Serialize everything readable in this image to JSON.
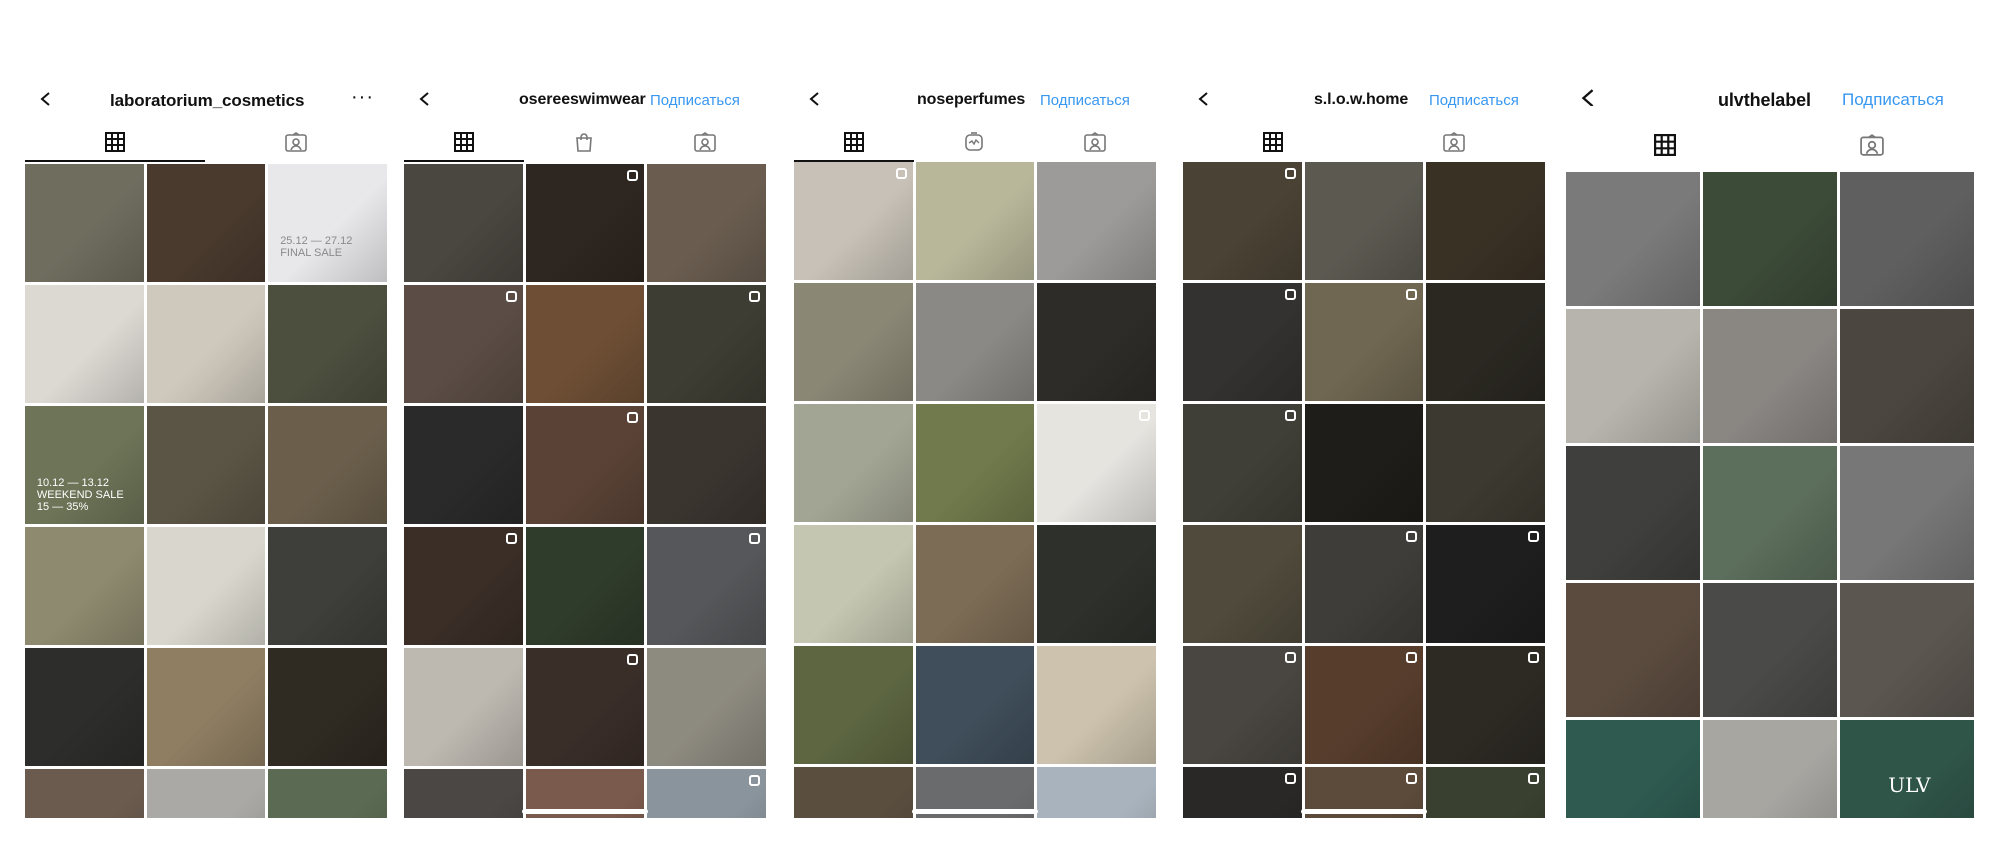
{
  "profiles": [
    {
      "username": "laboratorium_cosmetics",
      "action": "",
      "more": "···",
      "tabs": [
        "grid-icon",
        "tagged-icon"
      ],
      "tiles": [
        {
          "c": "#6f6d5e"
        },
        {
          "c": "#4a3a2e"
        },
        {
          "c": "#e8e8ea",
          "text": "25.12 — 27.12\nFINAL SALE",
          "dark": true
        },
        {
          "c": "#dcd9d3"
        },
        {
          "c": "#cfc9bd"
        },
        {
          "c": "#4c4f3e"
        },
        {
          "c": "#6d7457",
          "text": "10.12 — 13.12\nWEEKEND SALE\n15 — 35%"
        },
        {
          "c": "#5b5545"
        },
        {
          "c": "#6b5f4c"
        },
        {
          "c": "#8e8a6f"
        },
        {
          "c": "#d9d7cd"
        },
        {
          "c": "#3e3e3a"
        },
        {
          "c": "#2d2d2b"
        },
        {
          "c": "#8f7e62"
        },
        {
          "c": "#2f2a22"
        },
        {
          "c": "#6b5b4f"
        },
        {
          "c": "#aaa9a6"
        },
        {
          "c": "#5b6a52"
        }
      ]
    },
    {
      "username": "osereeswimwear",
      "action": "Подписаться",
      "tabs": [
        "grid-icon",
        "shop-icon",
        "tagged-icon"
      ],
      "tiles": [
        {
          "c": "#4a4640"
        },
        {
          "c": "#2e2620",
          "b": true
        },
        {
          "c": "#6a5d50"
        },
        {
          "c": "#5b4d45",
          "b": true
        },
        {
          "c": "#6e4f35"
        },
        {
          "c": "#3d3d33",
          "b": true
        },
        {
          "c": "#2a2a2a"
        },
        {
          "c": "#5a4336",
          "b": true
        },
        {
          "c": "#3b3530"
        },
        {
          "c": "#3a2e27",
          "b": true
        },
        {
          "c": "#2f3b2b"
        },
        {
          "c": "#56575a",
          "b": true
        },
        {
          "c": "#bdb8b0"
        },
        {
          "c": "#3a2e29",
          "b": true
        },
        {
          "c": "#8d8a80"
        },
        {
          "c": "#4a4744"
        },
        {
          "c": "#7a5a4c"
        },
        {
          "c": "#8a949c",
          "b": true
        }
      ]
    },
    {
      "username": "noseperfumes",
      "action": "Подписаться",
      "tabs": [
        "grid-icon",
        "reels-icon",
        "tagged-icon"
      ],
      "tiles": [
        {
          "c": "#c7c1b7",
          "b": true
        },
        {
          "c": "#b8b79a"
        },
        {
          "c": "#9c9b99"
        },
        {
          "c": "#8a8775"
        },
        {
          "c": "#8b8985"
        },
        {
          "c": "#2e2c28"
        },
        {
          "c": "#a3a594"
        },
        {
          "c": "#717a4c"
        },
        {
          "c": "#e6e4df",
          "b": true
        },
        {
          "c": "#c4c6b1"
        },
        {
          "c": "#7c6b55"
        },
        {
          "c": "#2d302b"
        },
        {
          "c": "#5d6641"
        },
        {
          "c": "#3f4e5a"
        },
        {
          "c": "#ccc2ad"
        },
        {
          "c": "#5a4e3f"
        },
        {
          "c": "#6a6b6d"
        },
        {
          "c": "#a9b3bd"
        }
      ]
    },
    {
      "username": "s.l.o.w.home",
      "action": "Подписаться",
      "tabs": [
        "grid-icon",
        "tagged-icon"
      ],
      "tiles": [
        {
          "c": "#4a4234",
          "b": true
        },
        {
          "c": "#5b5950"
        },
        {
          "c": "#3a3125"
        },
        {
          "c": "#333230",
          "b": true
        },
        {
          "c": "#6f6751",
          "b": true
        },
        {
          "c": "#2b2822"
        },
        {
          "c": "#3f3f37",
          "b": true
        },
        {
          "c": "#1f1d19"
        },
        {
          "c": "#3c3a30"
        },
        {
          "c": "#4f4a3b"
        },
        {
          "c": "#3e3d39",
          "b": true
        },
        {
          "c": "#1e1e1e",
          "b": true
        },
        {
          "c": "#494641",
          "b": true
        },
        {
          "c": "#573d2c",
          "b": true
        },
        {
          "c": "#2d2a24",
          "b": true
        },
        {
          "c": "#2a2826",
          "b": true
        },
        {
          "c": "#5c4a3a",
          "b": true
        },
        {
          "c": "#39402f",
          "b": true
        }
      ]
    },
    {
      "username": "ulvthelabel",
      "action": "Подписаться",
      "tabs": [
        "grid-icon",
        "tagged-icon"
      ],
      "tiles": [
        {
          "c": "#7a7a7a"
        },
        {
          "c": "#3c4a38"
        },
        {
          "c": "#5f5f5f"
        },
        {
          "c": "#b7b4ad"
        },
        {
          "c": "#8a8783"
        },
        {
          "c": "#4b463f"
        },
        {
          "c": "#3f3f3d"
        },
        {
          "c": "#5c6e5c"
        },
        {
          "c": "#777777"
        },
        {
          "c": "#5b4b3f"
        },
        {
          "c": "#4a4a48"
        },
        {
          "c": "#5b5650"
        },
        {
          "c": "#2e5a50"
        },
        {
          "c": "#a7a6a1"
        },
        {
          "c": "#2f5448",
          "text": "ULV"
        }
      ]
    }
  ]
}
